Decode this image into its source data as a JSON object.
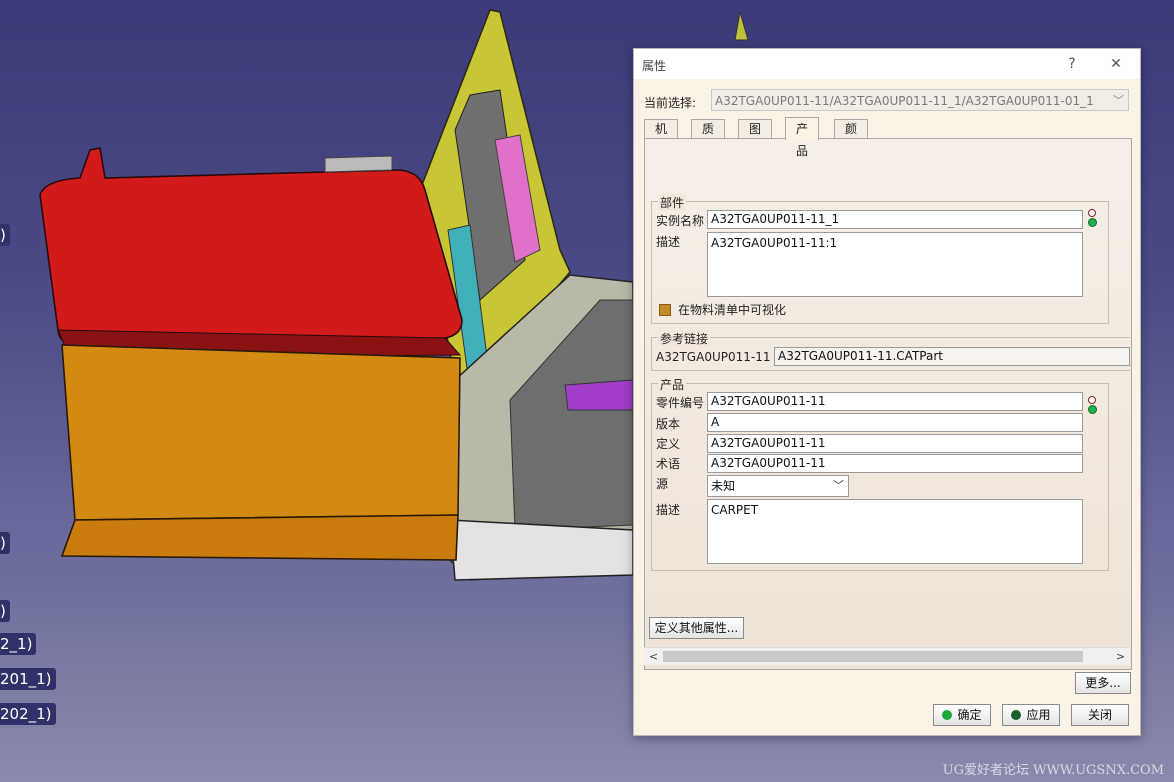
{
  "tree_labels": [
    ")",
    ")",
    ")",
    "2_1)",
    "201_1)",
    "202_1)"
  ],
  "watermark": "UG爱好者论坛 WWW.UGSNX.COM",
  "dialog": {
    "title": "属性",
    "help_icon": "?",
    "close_icon": "✕",
    "current_selection_label": "当前选择:",
    "current_selection_value": "A32TGA0UP011-11/A32TGA0UP011-11_1/A32TGA0UP011-01_1",
    "tabs": [
      "机械",
      "质量",
      "图形",
      "产品",
      "颜色"
    ],
    "active_tab": "产品",
    "component": {
      "title": "部件",
      "instance_name_label": "实例名称",
      "instance_name_value": "A32TGA0UP011-11_1",
      "description_label": "描述",
      "description_value": "A32TGA0UP011-11:1",
      "bom_visible_label": "在物料清单中可视化"
    },
    "reference_link": {
      "title": "参考链接",
      "name": "A32TGA0UP011-11",
      "file": "A32TGA0UP011-11.CATPart"
    },
    "product": {
      "title": "产品",
      "part_number_label": "零件编号",
      "part_number_value": "A32TGA0UP011-11",
      "revision_label": "版本",
      "revision_value": "A",
      "definition_label": "定义",
      "definition_value": "A32TGA0UP011-11",
      "nomenclature_label": "术语",
      "nomenclature_value": "A32TGA0UP011-11",
      "source_label": "源",
      "source_value": "未知",
      "description_label": "描述",
      "description_value": "CARPET"
    },
    "define_other_props_button": "定义其他属性...",
    "more_button": "更多...",
    "ok_button": "确定",
    "apply_button": "应用",
    "close_button": "关闭"
  },
  "colors": {
    "viewport_bg": "#3b3a78",
    "arrow": "#8ccf1a",
    "dialog_bg": "#fbf2e6"
  }
}
